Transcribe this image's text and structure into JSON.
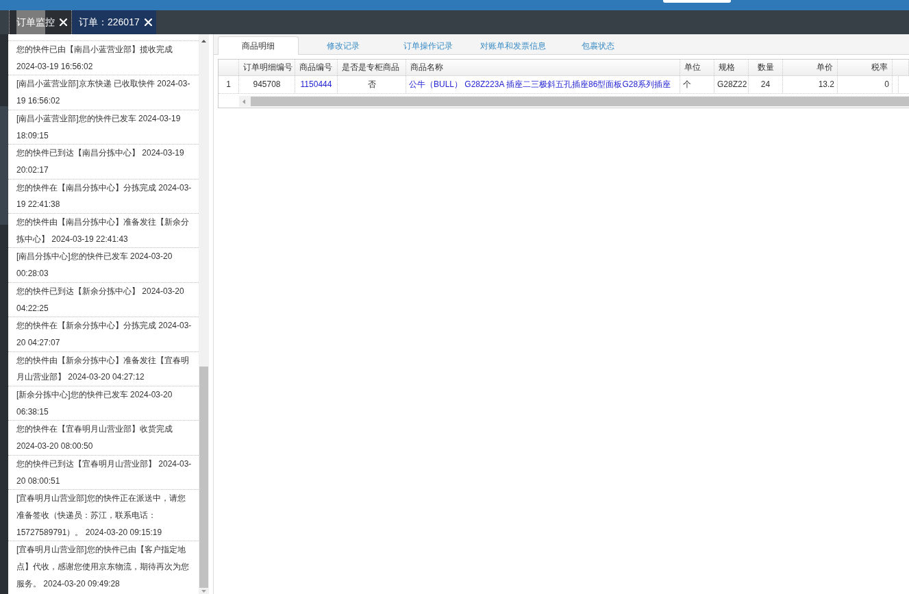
{
  "top_tabs": [
    {
      "label": "订单监控",
      "selected": false
    },
    {
      "label": "订单：226017",
      "selected": true
    }
  ],
  "tracking_log": [
    "您的快件已由【南昌小蓝营业部】揽收完成 2024-03-19 16:56:02",
    "[南昌小蓝营业部]京东快递 已收取快件 2024-03-19 16:56:02",
    "[南昌小蓝营业部]您的快件已发车 2024-03-19 18:09:15",
    "您的快件已到达【南昌分拣中心】 2024-03-19 20:02:17",
    "您的快件在【南昌分拣中心】分拣完成 2024-03-19 22:41:38",
    "您的快件由【南昌分拣中心】准备发往【新余分拣中心】 2024-03-19 22:41:43",
    "[南昌分拣中心]您的快件已发车 2024-03-20 00:28:03",
    "您的快件已到达【新余分拣中心】 2024-03-20 04:22:25",
    "您的快件在【新余分拣中心】分拣完成 2024-03-20 04:27:07",
    "您的快件由【新余分拣中心】准备发往【宜春明月山营业部】 2024-03-20 04:27:12",
    "[新余分拣中心]您的快件已发车 2024-03-20 06:38:15",
    "您的快件在【宜春明月山营业部】收货完成 2024-03-20 08:00:50",
    "您的快件已到达【宜春明月山营业部】 2024-03-20 08:00:51",
    "[宜春明月山营业部]您的快件正在派送中，请您准备签收（快递员：苏江，联系电话：15727589791）。 2024-03-20 09:15:19",
    "[宜春明月山营业部]您的快件已由【客户指定地点】代收，感谢您使用京东物流，期待再次为您服务。 2024-03-20 09:49:28"
  ],
  "detail_tabs": [
    {
      "label": "商品明细",
      "selected": true
    },
    {
      "label": "修改记录",
      "selected": false
    },
    {
      "label": "订单操作记录",
      "selected": false
    },
    {
      "label": "对账单和发票信息",
      "selected": false
    },
    {
      "label": "包裹状态",
      "selected": false
    }
  ],
  "table": {
    "columns": [
      "订单明细编号",
      "商品编号",
      "是否是专柜商品",
      "商品名称",
      "单位",
      "规格",
      "数量",
      "单价",
      "税率"
    ],
    "rows": [
      {
        "row_number": "1",
        "cells": [
          {
            "text": "945708",
            "kind": "text"
          },
          {
            "text": "1150444",
            "kind": "link"
          },
          {
            "text": "否",
            "kind": "text"
          },
          {
            "text": "公牛（BULL） G28Z223A 插座二三极斜五孔插座86型面板G28系列插座",
            "kind": "link"
          },
          {
            "text": "个",
            "kind": "text"
          },
          {
            "text": "G28Z22",
            "kind": "text"
          },
          {
            "text": "24",
            "kind": "text"
          },
          {
            "text": "13.2",
            "kind": "text"
          },
          {
            "text": "0",
            "kind": "text"
          }
        ]
      }
    ]
  }
}
